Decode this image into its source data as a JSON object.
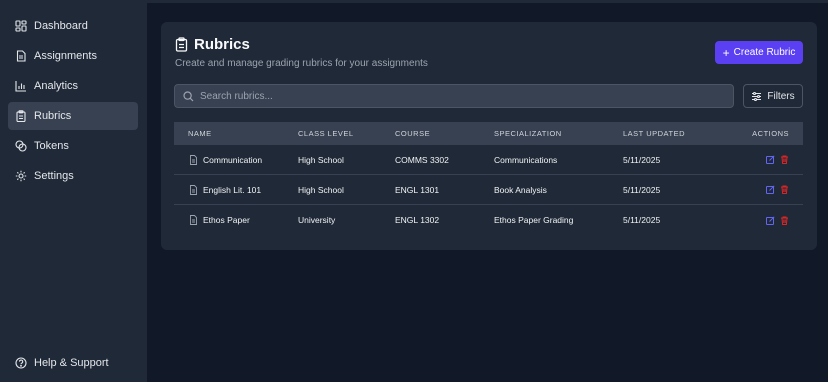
{
  "sidebar": {
    "items": [
      {
        "label": "Dashboard",
        "icon": "dashboard-icon"
      },
      {
        "label": "Assignments",
        "icon": "document-icon"
      },
      {
        "label": "Analytics",
        "icon": "bar-chart-icon"
      },
      {
        "label": "Rubrics",
        "icon": "clipboard-icon",
        "active": true
      },
      {
        "label": "Tokens",
        "icon": "coins-icon"
      },
      {
        "label": "Settings",
        "icon": "gear-icon"
      }
    ],
    "help_label": "Help & Support"
  },
  "page": {
    "title": "Rubrics",
    "subtitle": "Create and manage grading rubrics for your assignments",
    "create_label": "Create Rubric",
    "search_placeholder": "Search rubrics...",
    "filters_label": "Filters"
  },
  "table": {
    "headers": [
      "NAME",
      "CLASS LEVEL",
      "COURSE",
      "SPECIALIZATION",
      "LAST UPDATED",
      "ACTIONS"
    ],
    "rows": [
      {
        "name": "Communication",
        "class_level": "High School",
        "course": "COMMS 3302",
        "specialization": "Communications",
        "updated": "5/11/2025"
      },
      {
        "name": "English Lit. 101",
        "class_level": "High School",
        "course": "ENGL 1301",
        "specialization": "Book Analysis",
        "updated": "5/11/2025"
      },
      {
        "name": "Ethos Paper",
        "class_level": "University",
        "course": "ENGL 1302",
        "specialization": "Ethos Paper Grading",
        "updated": "5/11/2025"
      }
    ]
  },
  "colors": {
    "accent": "#5b3ff2",
    "edit": "#6366f1",
    "delete": "#dc2626",
    "background": "#111827",
    "panel": "#1f2937"
  }
}
